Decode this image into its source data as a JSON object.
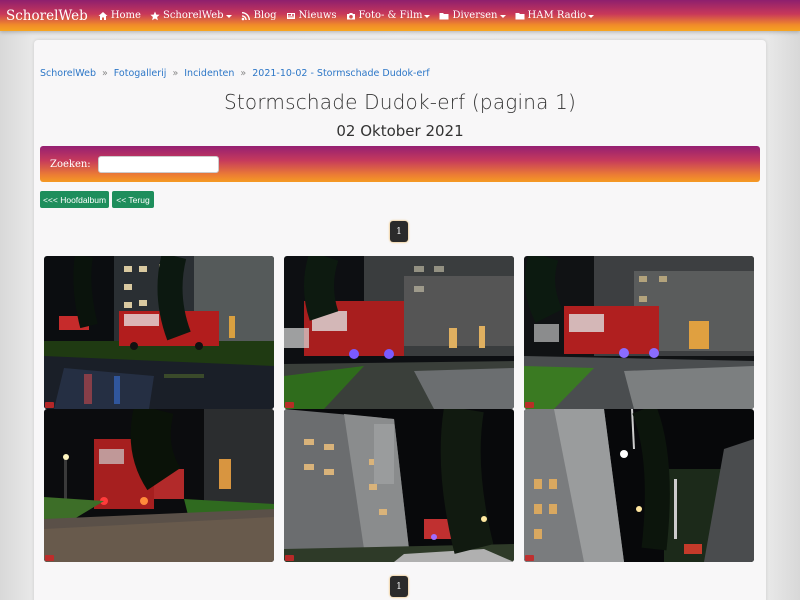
{
  "navbar": {
    "brand": "SchorelWeb",
    "items": [
      {
        "label": "Home",
        "icon": "home-icon",
        "dropdown": false
      },
      {
        "label": "SchorelWeb",
        "icon": "star-icon",
        "dropdown": true
      },
      {
        "label": "Blog",
        "icon": "rss-icon",
        "dropdown": false
      },
      {
        "label": "Nieuws",
        "icon": "newspaper-icon",
        "dropdown": false
      },
      {
        "label": "Foto- & Film",
        "icon": "camera-icon",
        "dropdown": true
      },
      {
        "label": "Diversen",
        "icon": "folder-icon",
        "dropdown": true
      },
      {
        "label": "HAM Radio",
        "icon": "folder-icon",
        "dropdown": true
      }
    ]
  },
  "breadcrumb": [
    "SchorelWeb",
    "Fotogallerij",
    "Incidenten",
    "2021-10-02 - Stormschade Dudok-erf"
  ],
  "page": {
    "title": "Stormschade Dudok-erf (pagina 1)",
    "subtitle": "02 Oktober 2021"
  },
  "search": {
    "label": "Zoeken:",
    "value": "",
    "placeholder": ""
  },
  "buttons": {
    "main_album": "<<< Hoofdalbum",
    "back": "<< Terug"
  },
  "pagination": {
    "current": "1"
  },
  "colors": {
    "accent_start": "#8e1f6e",
    "accent_end": "#f6a520",
    "button": "#1e8e5c",
    "link": "#2d77c7"
  },
  "photos": [
    {
      "name": "photo-1"
    },
    {
      "name": "photo-2"
    },
    {
      "name": "photo-3"
    },
    {
      "name": "photo-4"
    },
    {
      "name": "photo-5"
    },
    {
      "name": "photo-6"
    }
  ]
}
